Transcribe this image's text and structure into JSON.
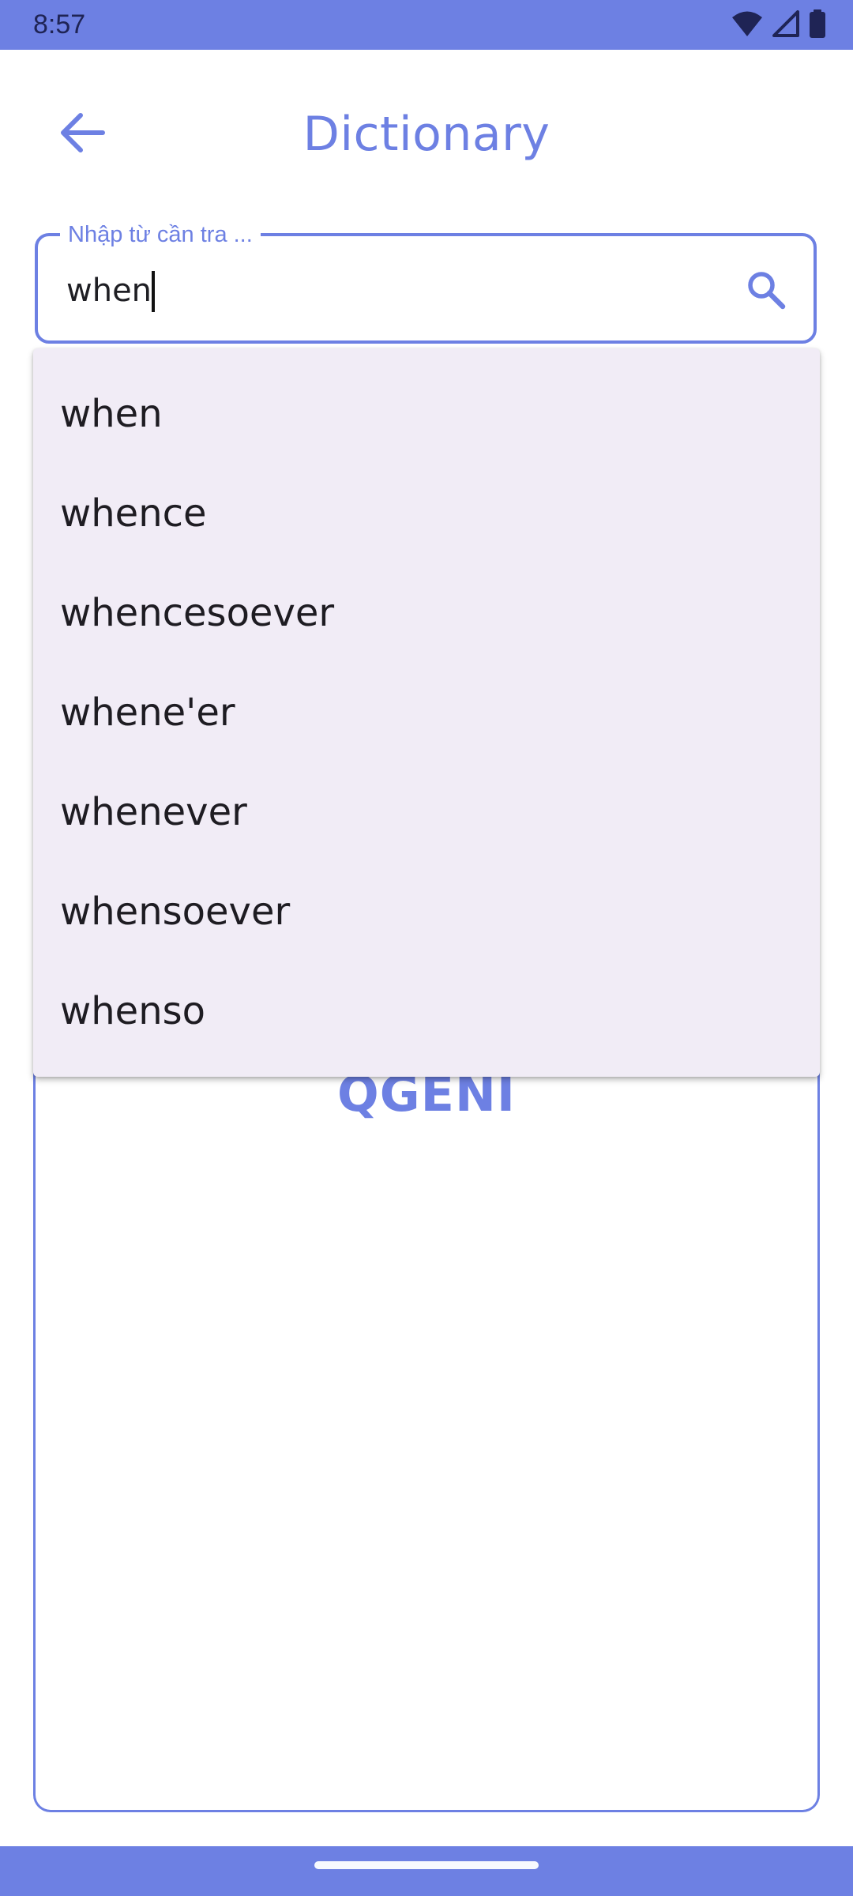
{
  "status_bar": {
    "time": "8:57",
    "icons": [
      "wifi-icon",
      "cellular-signal-icon",
      "battery-icon"
    ]
  },
  "header": {
    "title": "Dictionary",
    "back_icon": "arrow-left-icon"
  },
  "search": {
    "label": "Nhập từ cần tra ...",
    "value": "when",
    "search_icon": "search-icon"
  },
  "suggestions": [
    "when",
    "whence",
    "whencesoever",
    "whene'er",
    "whenever",
    "whensoever",
    "whenso"
  ],
  "content": {
    "brand": "QGENI"
  },
  "colors": {
    "accent": "#6D80E3",
    "dropdown_bg": "#F1ECF6",
    "text": "#1E1C22"
  }
}
